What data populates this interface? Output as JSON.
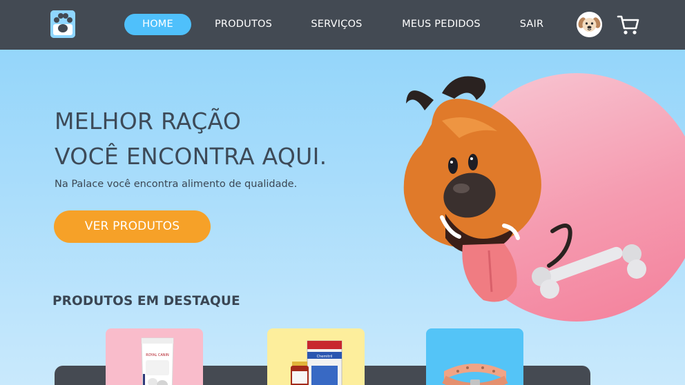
{
  "nav": {
    "logo_icon": "paw-icon",
    "links": [
      {
        "label": "HOME",
        "active": true
      },
      {
        "label": "PRODUTOS",
        "active": false
      },
      {
        "label": "SERVIÇOS",
        "active": false
      },
      {
        "label": "MEUS PEDIDOS",
        "active": false
      },
      {
        "label": "SAIR",
        "active": false
      }
    ],
    "avatar_icon": "dog-face-icon",
    "cart_icon": "cart-icon",
    "background_color": "#434a53",
    "active_color": "#4fc0fb"
  },
  "hero": {
    "title_line1": "MELHOR RAÇÃO",
    "title_line2": "VOCÊ ENCONTRA AQUI.",
    "subtitle": "Na Palace você encontra alimento de qualidade.",
    "cta_label": "VER PRODUTOS",
    "cta_color": "#f6a128",
    "illustration": "cartoon-dog-with-bone"
  },
  "featured": {
    "title": "PRODUTOS EM DESTAQUE",
    "products": [
      {
        "image": "dog-food-bag",
        "color": "#f9bccb"
      },
      {
        "image": "medicine-bottle-and-box",
        "color": "#fdee9c"
      },
      {
        "image": "pet-collar",
        "color": "#54c4f7"
      }
    ]
  }
}
